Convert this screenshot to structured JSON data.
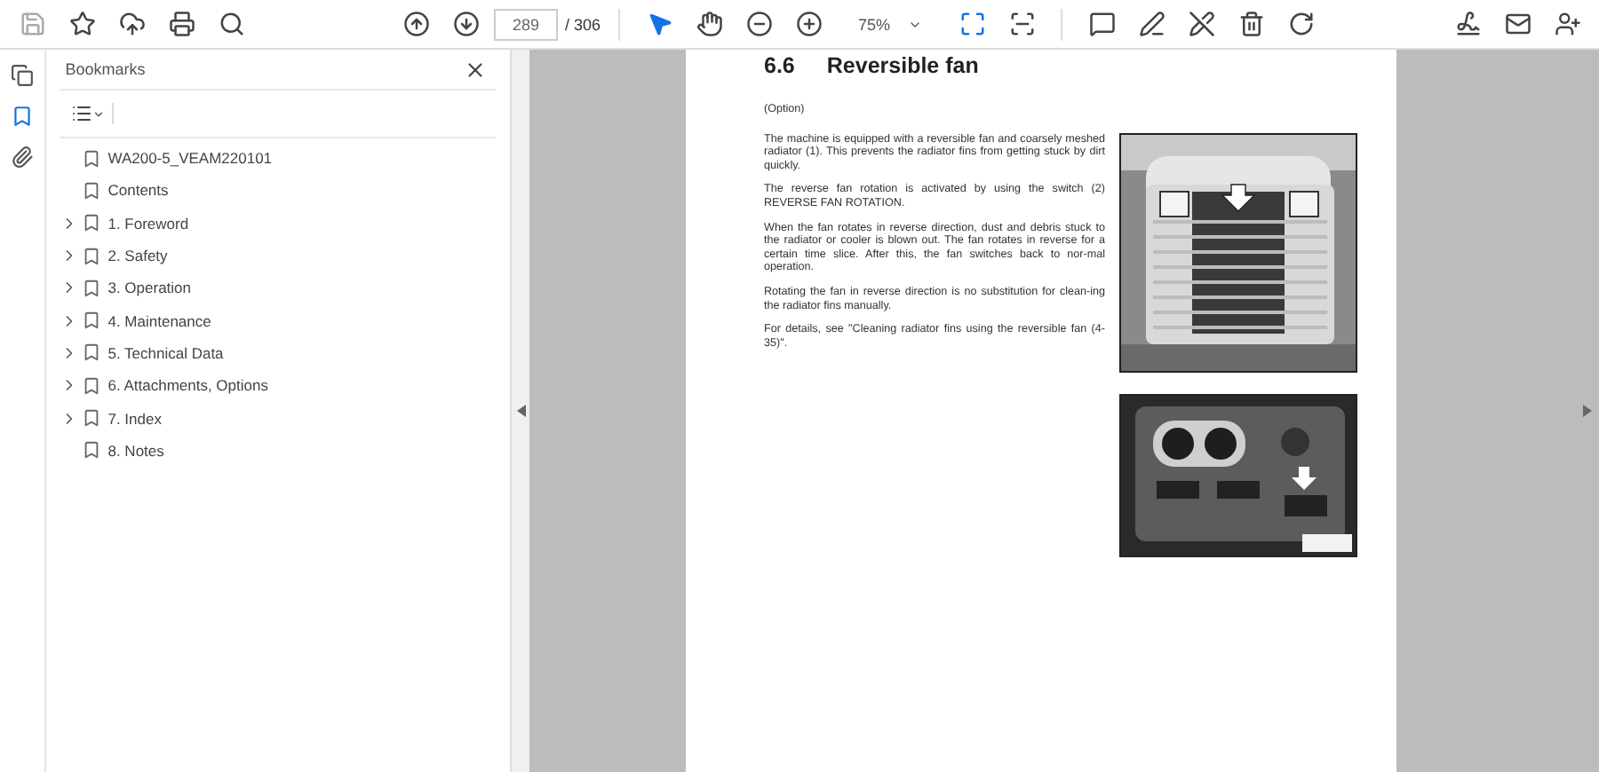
{
  "toolbar": {
    "page_number": "289",
    "page_total": "/ 306",
    "zoom": "75%"
  },
  "rail": [
    {
      "kind": "pages",
      "selected": false
    },
    {
      "kind": "bookmarks",
      "selected": true
    },
    {
      "kind": "attachments",
      "selected": false
    }
  ],
  "bookmarks": {
    "title": "Bookmarks",
    "items": [
      {
        "label": "WA200-5_VEAM220101",
        "has_children": false
      },
      {
        "label": "Contents",
        "has_children": false
      },
      {
        "label": "1. Foreword",
        "has_children": true,
        "expanded": false
      },
      {
        "label": "2. Safety",
        "has_children": true,
        "expanded": false
      },
      {
        "label": "3. Operation",
        "has_children": true,
        "expanded": false
      },
      {
        "label": "4. Maintenance",
        "has_children": true,
        "expanded": false
      },
      {
        "label": "5. Technical Data",
        "has_children": true,
        "expanded": false
      },
      {
        "label": "6. Attachments, Options",
        "has_children": true,
        "expanded": false
      },
      {
        "label": "7. Index",
        "has_children": true,
        "expanded": false
      },
      {
        "label": "8. Notes",
        "has_children": false
      }
    ]
  },
  "page": {
    "section_number": "6.6",
    "section_title": "Reversible fan",
    "paragraphs": [
      "(Option)",
      "The machine is equipped with a reversible fan and coarsely meshed radiator (1). This prevents the radiator fins from getting stuck by dirt quickly.",
      "The reverse fan rotation is activated by using the switch (2) REVERSE FAN ROTATION.",
      "When the fan rotates in reverse direction, dust and debris stuck to the radiator or cooler is blown out. The fan rotates in reverse for a certain time slice. After this, the fan switches back to nor-mal operation.",
      "Rotating the fan in reverse direction is no substitution for clean-ing the radiator fins manually.",
      "For details, see \"Cleaning radiator fins using the reversible fan (4-35)\"."
    ]
  }
}
